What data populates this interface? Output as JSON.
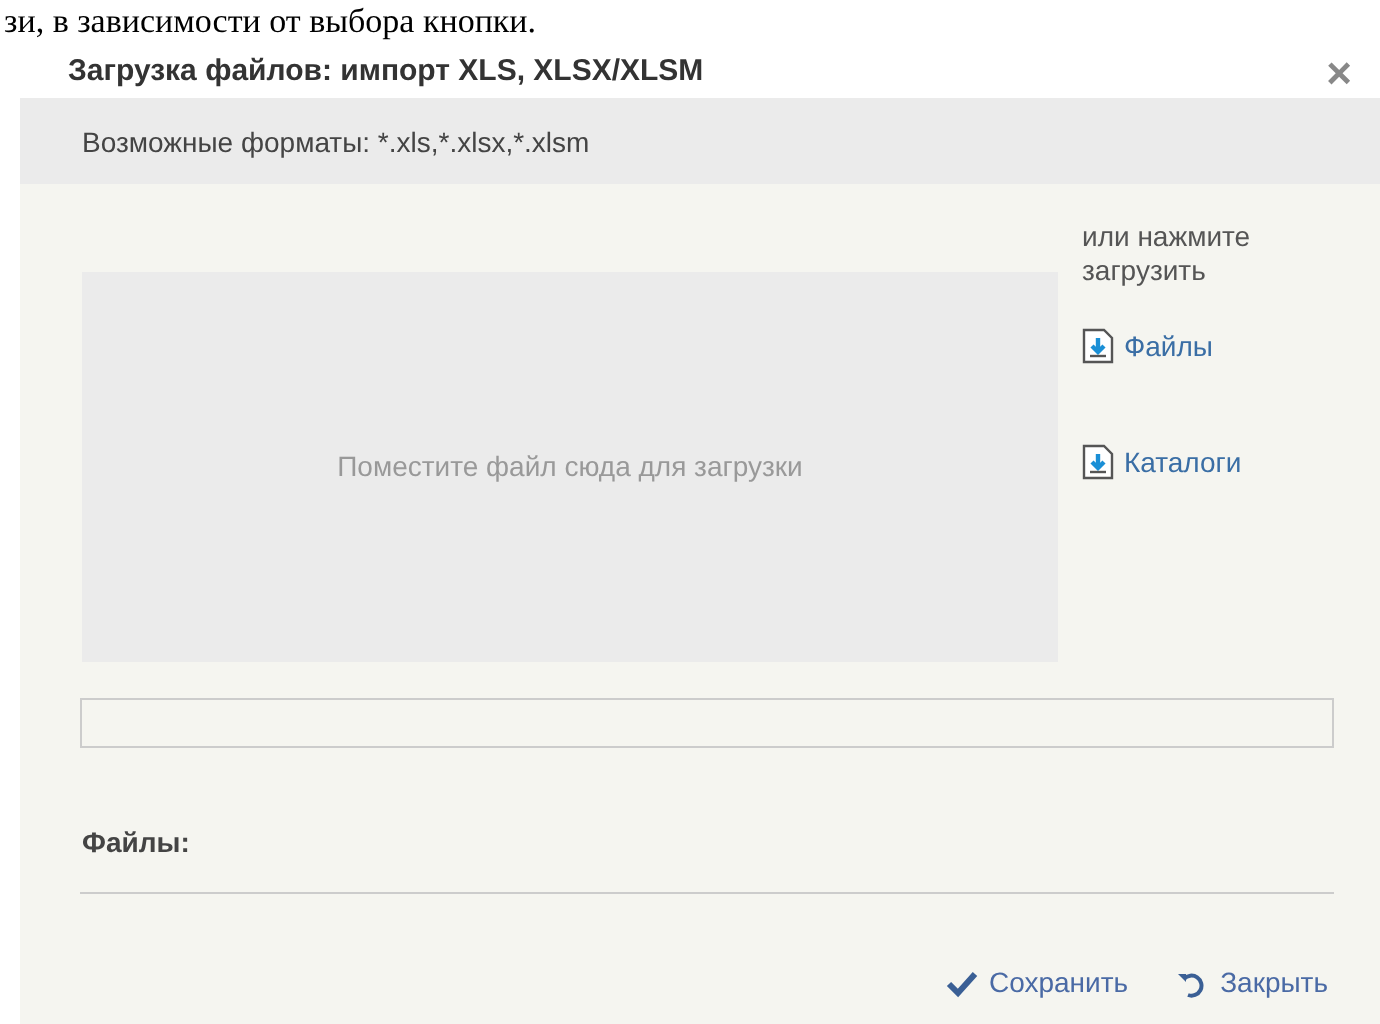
{
  "background_text": "зи, в зависимости от выбора кнопки.",
  "dialog": {
    "title": "Загрузка файлов: импорт XLS, XLSX/XLSM",
    "close": "×"
  },
  "formats_note": "Возможные форматы: *.xls,*.xlsx,*.xlsm",
  "drop_zone": {
    "text": "Поместите файл сюда для загрузки"
  },
  "upload_hint": "или нажмите загрузить",
  "upload_links": [
    {
      "label": "Файлы"
    },
    {
      "label": "Каталоги"
    }
  ],
  "progress": {
    "level": 0
  },
  "files_label": "Файлы:",
  "buttons": [
    {
      "kind": "save",
      "label": "Сохранить"
    },
    {
      "kind": "close",
      "label": "Закрыть"
    }
  ]
}
